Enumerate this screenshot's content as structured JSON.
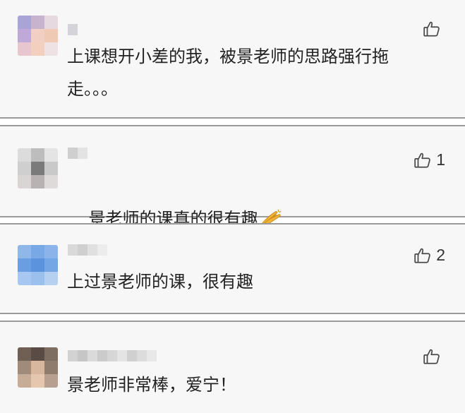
{
  "comments": [
    {
      "text": "上课想开小差的我，被景老师的思路强行拖走。。。",
      "likes": ""
    },
    {
      "text": "景老师的课真的很有趣",
      "likes": "1",
      "emoji": "clap-hands-icon"
    },
    {
      "text": "上过景老师的课，很有趣",
      "likes": "2"
    },
    {
      "text": "景老师非常棒，爱宁！",
      "likes": ""
    }
  ],
  "colors": {
    "card_bg": "#f7f7f7",
    "divider": "#9a9a9a",
    "text": "#222222",
    "icon": "#4a4a4a"
  }
}
